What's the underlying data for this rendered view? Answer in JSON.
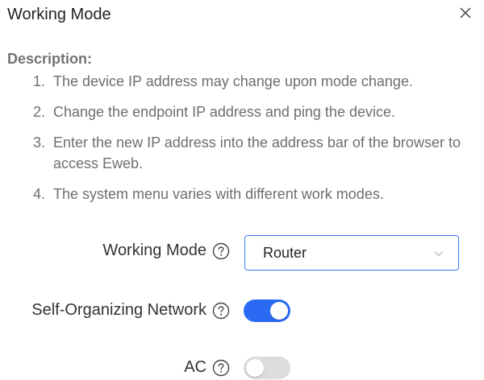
{
  "dialog": {
    "title": "Working Mode"
  },
  "description": {
    "heading": "Description:",
    "items": [
      {
        "num": "1.",
        "text": "The device IP address may change upon mode change."
      },
      {
        "num": "2.",
        "text": "Change the endpoint IP address and ping the device."
      },
      {
        "num": "3.",
        "text": "Enter the new IP address into the address bar of the browser to access Eweb."
      },
      {
        "num": "4.",
        "text": "The system menu varies with different work modes."
      }
    ]
  },
  "form": {
    "working_mode": {
      "label": "Working Mode",
      "value": "Router"
    },
    "self_organizing": {
      "label": "Self-Organizing Network",
      "enabled": true
    },
    "ac": {
      "label": "AC",
      "enabled": false
    }
  },
  "colors": {
    "accent": "#2b6bf3",
    "toggle_off": "#dcdcdc"
  },
  "icons": {
    "close": "close-icon",
    "help": "question-circle-icon",
    "chevron": "chevron-down-icon"
  }
}
